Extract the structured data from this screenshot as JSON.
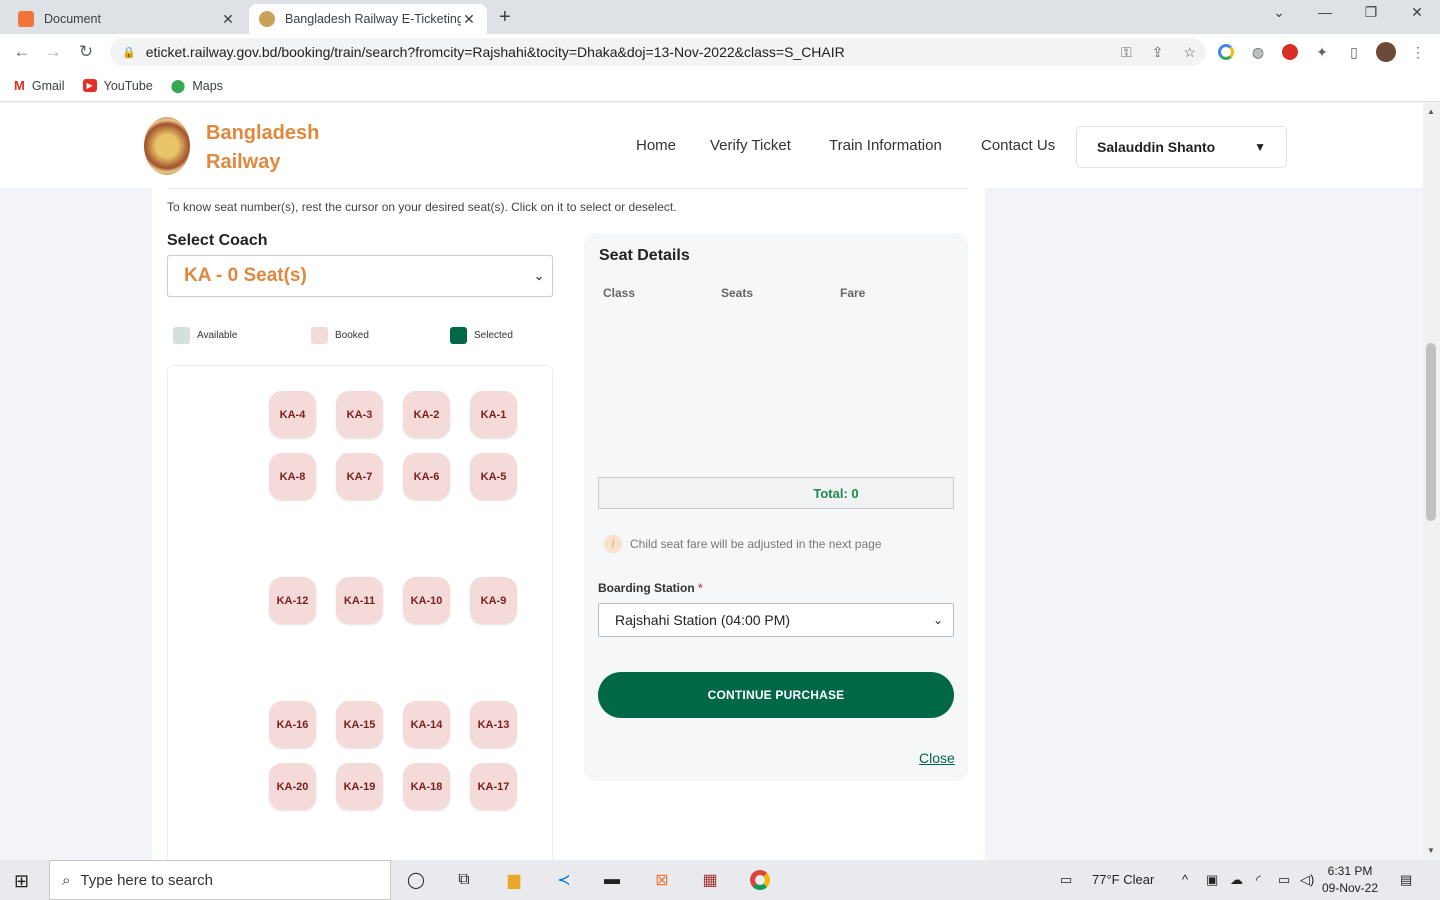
{
  "browser": {
    "tabs": [
      {
        "title": "Document",
        "active": false
      },
      {
        "title": "Bangladesh Railway E-Ticketing S",
        "active": true
      }
    ],
    "url": "eticket.railway.gov.bd/booking/train/search?fromcity=Rajshahi&tocity=Dhaka&doj=13-Nov-2022&class=S_CHAIR",
    "bookmarks": [
      "Gmail",
      "YouTube",
      "Maps"
    ]
  },
  "header": {
    "brand_line1": "Bangladesh",
    "brand_line2": "Railway",
    "nav": [
      "Home",
      "Verify Ticket",
      "Train Information",
      "Contact Us"
    ],
    "user": "Salauddin Shanto"
  },
  "booking": {
    "hint": "To know seat number(s), rest the cursor on your desired seat(s). Click on it to select or deselect.",
    "select_coach_label": "Select Coach",
    "coach_value": "KA - 0 Seat(s)",
    "legend": {
      "available": "Available",
      "booked": "Booked",
      "selected": "Selected"
    },
    "seat_rows": [
      [
        "KA-4",
        "KA-3",
        "KA-2",
        "KA-1"
      ],
      [
        "KA-8",
        "KA-7",
        "KA-6",
        "KA-5"
      ],
      [
        "KA-12",
        "KA-11",
        "KA-10",
        "KA-9"
      ],
      [
        "KA-16",
        "KA-15",
        "KA-14",
        "KA-13"
      ],
      [
        "KA-20",
        "KA-19",
        "KA-18",
        "KA-17"
      ]
    ]
  },
  "details": {
    "title": "Seat Details",
    "col_class": "Class",
    "col_seats": "Seats",
    "col_fare": "Fare",
    "total": "Total: 0",
    "note": "Child seat fare will be adjusted in the next page",
    "boarding_label": "Boarding Station",
    "required_mark": "*",
    "boarding_value": "Rajshahi Station (04:00 PM)",
    "cta": "CONTINUE PURCHASE",
    "close": "Close"
  },
  "colors": {
    "brand_orange": "#e0883e",
    "primary_green": "#006747",
    "available": "#d4e0dc",
    "booked": "#f5dada",
    "selected": "#006747"
  },
  "taskbar": {
    "search_placeholder": "Type here to search",
    "weather": "77°F  Clear",
    "time": "6:31 PM",
    "date": "09-Nov-22"
  }
}
